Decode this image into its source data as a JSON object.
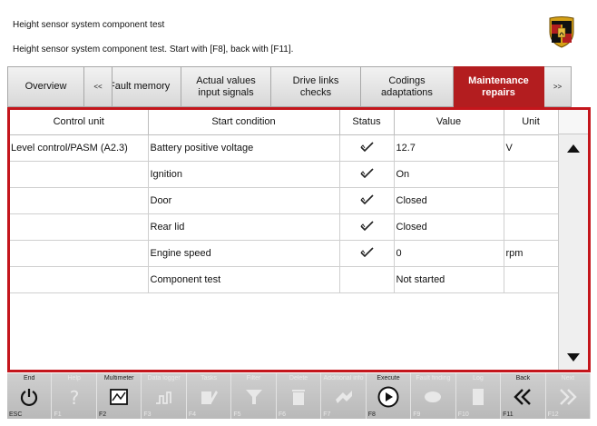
{
  "header": {
    "title": "Height sensor system component test",
    "subtitle": "Height sensor system component test. Start with [F8], back with [F11]."
  },
  "tabs": [
    {
      "label": "Overview",
      "active": false
    },
    {
      "label": "<<",
      "active": false
    },
    {
      "label": "Fault memory",
      "active": false
    },
    {
      "label": "Actual values input signals",
      "line1": "Actual values",
      "line2": "input signals",
      "active": false
    },
    {
      "label": "Drive links checks",
      "line1": "Drive links",
      "line2": "checks",
      "active": false
    },
    {
      "label": "Codings adaptations",
      "line1": "Codings",
      "line2": "adaptations",
      "active": false
    },
    {
      "label": "Maintenance repairs",
      "line1": "Maintenance",
      "line2": "repairs",
      "active": true
    },
    {
      "label": ">>",
      "active": false
    }
  ],
  "table": {
    "columns": [
      "Control unit",
      "Start condition",
      "Status",
      "Value",
      "Unit"
    ],
    "rows": [
      {
        "control_unit": "Level control/PASM (A2.3)",
        "condition": "Battery positive voltage",
        "status": "check",
        "value": "12.7",
        "unit": "V"
      },
      {
        "control_unit": "",
        "condition": "Ignition",
        "status": "check",
        "value": "On",
        "unit": ""
      },
      {
        "control_unit": "",
        "condition": "Door",
        "status": "check",
        "value": "Closed",
        "unit": ""
      },
      {
        "control_unit": "",
        "condition": "Rear lid",
        "status": "check",
        "value": "Closed",
        "unit": ""
      },
      {
        "control_unit": "",
        "condition": "Engine speed",
        "status": "check",
        "value": "0",
        "unit": "rpm"
      },
      {
        "control_unit": "",
        "condition": "Component test",
        "status": "",
        "value": "Not started",
        "unit": ""
      }
    ]
  },
  "fkeys": [
    {
      "name": "End",
      "code": "ESC",
      "icon": "power-icon",
      "enabled": true
    },
    {
      "name": "Help",
      "code": "F1",
      "icon": "help-icon",
      "enabled": false
    },
    {
      "name": "Multimeter",
      "code": "F2",
      "icon": "multimeter-icon",
      "enabled": true
    },
    {
      "name": "Data logger",
      "code": "F3",
      "icon": "oscilloscope-icon",
      "enabled": false
    },
    {
      "name": "Tasks",
      "code": "F4",
      "icon": "tasks-icon",
      "enabled": false
    },
    {
      "name": "Filter",
      "code": "F5",
      "icon": "filter-icon",
      "enabled": false
    },
    {
      "name": "Delete",
      "code": "F6",
      "icon": "trash-icon",
      "enabled": false
    },
    {
      "name": "Additional info",
      "code": "F7",
      "icon": "info-icon",
      "enabled": false
    },
    {
      "name": "Execute",
      "code": "F8",
      "icon": "execute-icon",
      "enabled": true
    },
    {
      "name": "Fault finding",
      "code": "F9",
      "icon": "fault-finding-icon",
      "enabled": false
    },
    {
      "name": "Log",
      "code": "F10",
      "icon": "log-icon",
      "enabled": false
    },
    {
      "name": "Back",
      "code": "F11",
      "icon": "back-icon",
      "enabled": true
    },
    {
      "name": "Next",
      "code": "F12",
      "icon": "next-icon",
      "enabled": false
    }
  ],
  "colors": {
    "accent": "#c4161c",
    "tab_active": "#b31d1f",
    "fbar": "#c4c4c4"
  }
}
